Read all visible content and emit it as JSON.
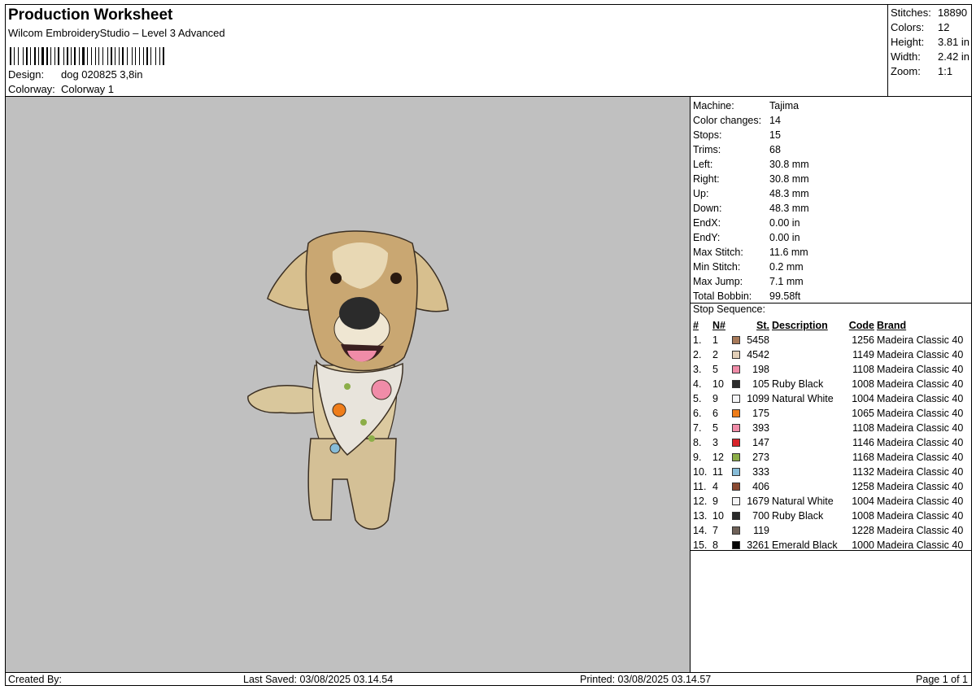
{
  "header": {
    "title": "Production Worksheet",
    "subtitle": "Wilcom EmbroideryStudio – Level 3 Advanced",
    "design_label": "Design:",
    "design_value": "dog 020825 3,8in",
    "colorway_label": "Colorway:",
    "colorway_value": "Colorway 1"
  },
  "summary": [
    {
      "label": "Stitches:",
      "value": "18890"
    },
    {
      "label": "Colors:",
      "value": "12"
    },
    {
      "label": "Height:",
      "value": "3.81 in"
    },
    {
      "label": "Width:",
      "value": "2.42 in"
    },
    {
      "label": "Zoom:",
      "value": "1:1"
    }
  ],
  "machine_info": [
    {
      "label": "Machine:",
      "value": "Tajima"
    },
    {
      "label": "Color changes:",
      "value": "14"
    },
    {
      "label": "Stops:",
      "value": "15"
    },
    {
      "label": "Trims:",
      "value": "68"
    },
    {
      "label": "Left:",
      "value": "30.8 mm"
    },
    {
      "label": "Right:",
      "value": "30.8 mm"
    },
    {
      "label": "Up:",
      "value": "48.3 mm"
    },
    {
      "label": "Down:",
      "value": "48.3 mm"
    },
    {
      "label": "EndX:",
      "value": "0.00 in"
    },
    {
      "label": "EndY:",
      "value": "0.00 in"
    },
    {
      "label": "Max Stitch:",
      "value": "11.6 mm"
    },
    {
      "label": "Min Stitch:",
      "value": "0.2 mm"
    },
    {
      "label": "Max Jump:",
      "value": "7.1 mm"
    },
    {
      "label": "Total Bobbin:",
      "value": "99.58ft"
    }
  ],
  "stop_sequence": {
    "title": "Stop Sequence:",
    "columns": {
      "num": "#",
      "n": "N#",
      "st": "St.",
      "desc": "Description",
      "code": "Code",
      "brand": "Brand"
    },
    "rows": [
      {
        "num": "1.",
        "n": "1",
        "color": "#a87a5a",
        "st": "5458",
        "desc": "",
        "code": "1256",
        "brand": "Madeira Classic 40"
      },
      {
        "num": "2.",
        "n": "2",
        "color": "#e2cfb8",
        "st": "4542",
        "desc": "",
        "code": "1149",
        "brand": "Madeira Classic 40"
      },
      {
        "num": "3.",
        "n": "5",
        "color": "#f08ca8",
        "st": "198",
        "desc": "",
        "code": "1108",
        "brand": "Madeira Classic 40"
      },
      {
        "num": "4.",
        "n": "10",
        "color": "#2a2a2a",
        "st": "105",
        "desc": "Ruby Black",
        "code": "1008",
        "brand": "Madeira Classic 40"
      },
      {
        "num": "5.",
        "n": "9",
        "color": "#f4f4f6",
        "st": "1099",
        "desc": "Natural White",
        "code": "1004",
        "brand": "Madeira Classic 40"
      },
      {
        "num": "6.",
        "n": "6",
        "color": "#ef7d1a",
        "st": "175",
        "desc": "",
        "code": "1065",
        "brand": "Madeira Classic 40"
      },
      {
        "num": "7.",
        "n": "5",
        "color": "#f08ca8",
        "st": "393",
        "desc": "",
        "code": "1108",
        "brand": "Madeira Classic 40"
      },
      {
        "num": "8.",
        "n": "3",
        "color": "#d8242a",
        "st": "147",
        "desc": "",
        "code": "1146",
        "brand": "Madeira Classic 40"
      },
      {
        "num": "9.",
        "n": "12",
        "color": "#8cae48",
        "st": "273",
        "desc": "",
        "code": "1168",
        "brand": "Madeira Classic 40"
      },
      {
        "num": "10.",
        "n": "11",
        "color": "#86bcd8",
        "st": "333",
        "desc": "",
        "code": "1132",
        "brand": "Madeira Classic 40"
      },
      {
        "num": "11.",
        "n": "4",
        "color": "#8a4a32",
        "st": "406",
        "desc": "",
        "code": "1258",
        "brand": "Madeira Classic 40"
      },
      {
        "num": "12.",
        "n": "9",
        "color": "#f4f4f6",
        "st": "1679",
        "desc": "Natural White",
        "code": "1004",
        "brand": "Madeira Classic 40"
      },
      {
        "num": "13.",
        "n": "10",
        "color": "#2a2a2a",
        "st": "700",
        "desc": "Ruby Black",
        "code": "1008",
        "brand": "Madeira Classic 40"
      },
      {
        "num": "14.",
        "n": "7",
        "color": "#6f6158",
        "st": "119",
        "desc": "",
        "code": "1228",
        "brand": "Madeira Classic 40"
      },
      {
        "num": "15.",
        "n": "8",
        "color": "#050505",
        "st": "3261",
        "desc": "Emerald Black",
        "code": "1000",
        "brand": "Madeira Classic 40"
      }
    ]
  },
  "preview": {
    "background": "#c0c0c0",
    "subject": "embroidered golden retriever with bandana"
  },
  "footer": {
    "created_by": "Created By:",
    "last_saved": "Last Saved: 03/08/2025 03.14.54",
    "printed": "Printed: 03/08/2025 03.14.57",
    "page": "Page 1 of 1"
  }
}
